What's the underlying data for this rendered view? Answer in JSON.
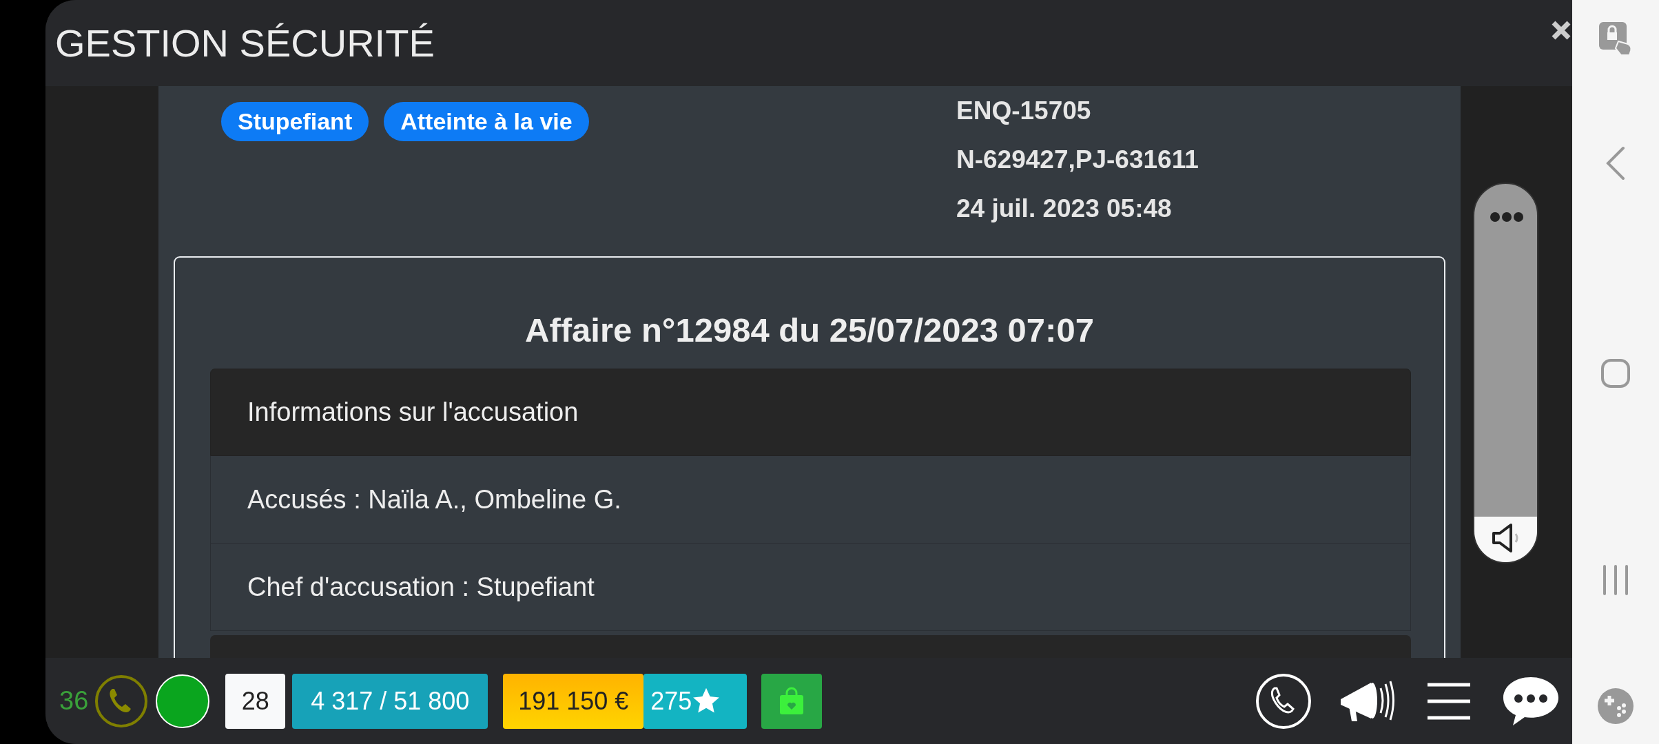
{
  "window": {
    "title": "GESTION SÉCURITÉ"
  },
  "tags": [
    "Stupefiant",
    "Atteinte à la vie"
  ],
  "references": [
    "ENQ-15705",
    "N-629427,PJ-631611",
    "24 juil. 2023 05:48"
  ],
  "case": {
    "title": "Affaire n°12984 du 25/07/2023 07:07",
    "sections": [
      {
        "header": "Informations sur l'accusation",
        "items": [
          "Accusés : Naïla A., Ombeline G.",
          "Chef d'accusation : Stupefiant"
        ]
      }
    ]
  },
  "volume": {
    "level": 0.12
  },
  "status_bar": {
    "count": "36",
    "online": true,
    "counter": "28",
    "capacity": "4 317 / 51 800",
    "money": "191 150 €",
    "stars": "275"
  }
}
